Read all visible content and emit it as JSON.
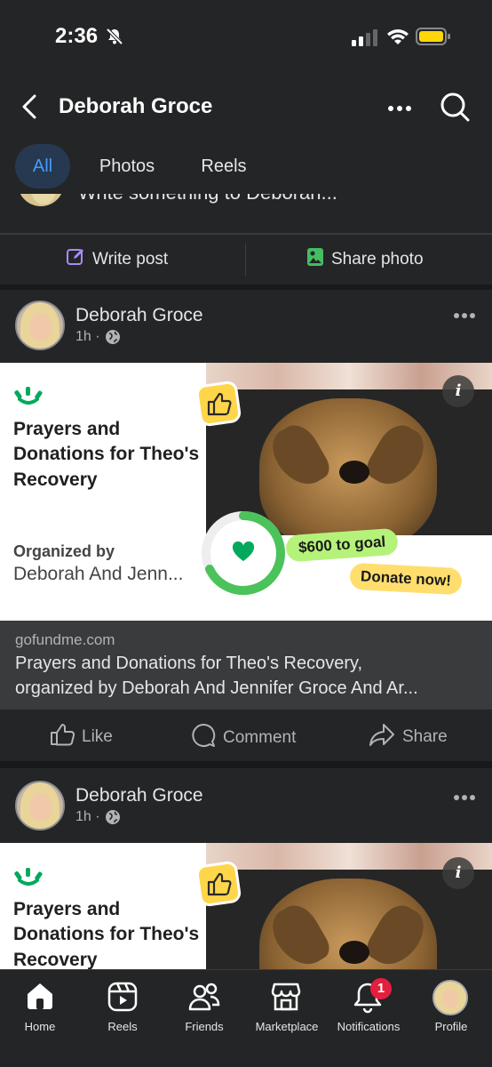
{
  "status_bar": {
    "time": "2:36"
  },
  "header": {
    "title": "Deborah Groce"
  },
  "tabs": [
    {
      "label": "All",
      "active": true
    },
    {
      "label": "Photos",
      "active": false
    },
    {
      "label": "Reels",
      "active": false
    }
  ],
  "composer": {
    "placeholder": "Write something to Deborah...",
    "write_post": "Write post",
    "share_photo": "Share photo"
  },
  "posts": [
    {
      "author": "Deborah Groce",
      "time": "1h · ",
      "fundraiser": {
        "title_line1": "Prayers and",
        "title_line2": "Donations for Theo's",
        "title_line3": "Recovery",
        "organized_label": "Organized by",
        "organizer": "Deborah And Jenn...",
        "goal_text": "$600 to goal",
        "donate_text": "Donate now!"
      },
      "link": {
        "domain": "gofundme.com",
        "title_line1": "Prayers and Donations for Theo's Recovery,",
        "title_line2": "organized by Deborah And Jennifer Groce And Ar..."
      },
      "actions": {
        "like": "Like",
        "comment": "Comment",
        "share": "Share"
      }
    },
    {
      "author": "Deborah Groce",
      "time": "1h · ",
      "fundraiser": {
        "title_line1": "Prayers and",
        "title_line2": "Donations for Theo's",
        "title_line3": "Recovery"
      }
    }
  ],
  "bottom_nav": [
    {
      "label": "Home",
      "icon": "home-icon"
    },
    {
      "label": "Reels",
      "icon": "reels-icon"
    },
    {
      "label": "Friends",
      "icon": "friends-icon"
    },
    {
      "label": "Marketplace",
      "icon": "marketplace-icon"
    },
    {
      "label": "Notifications",
      "icon": "bell-icon",
      "badge": "1"
    },
    {
      "label": "Profile",
      "icon": "avatar"
    }
  ],
  "colors": {
    "background": "#242526",
    "accent": "#4599ff",
    "gofundme_green": "#02a95c",
    "badge": "#e41e3f"
  }
}
